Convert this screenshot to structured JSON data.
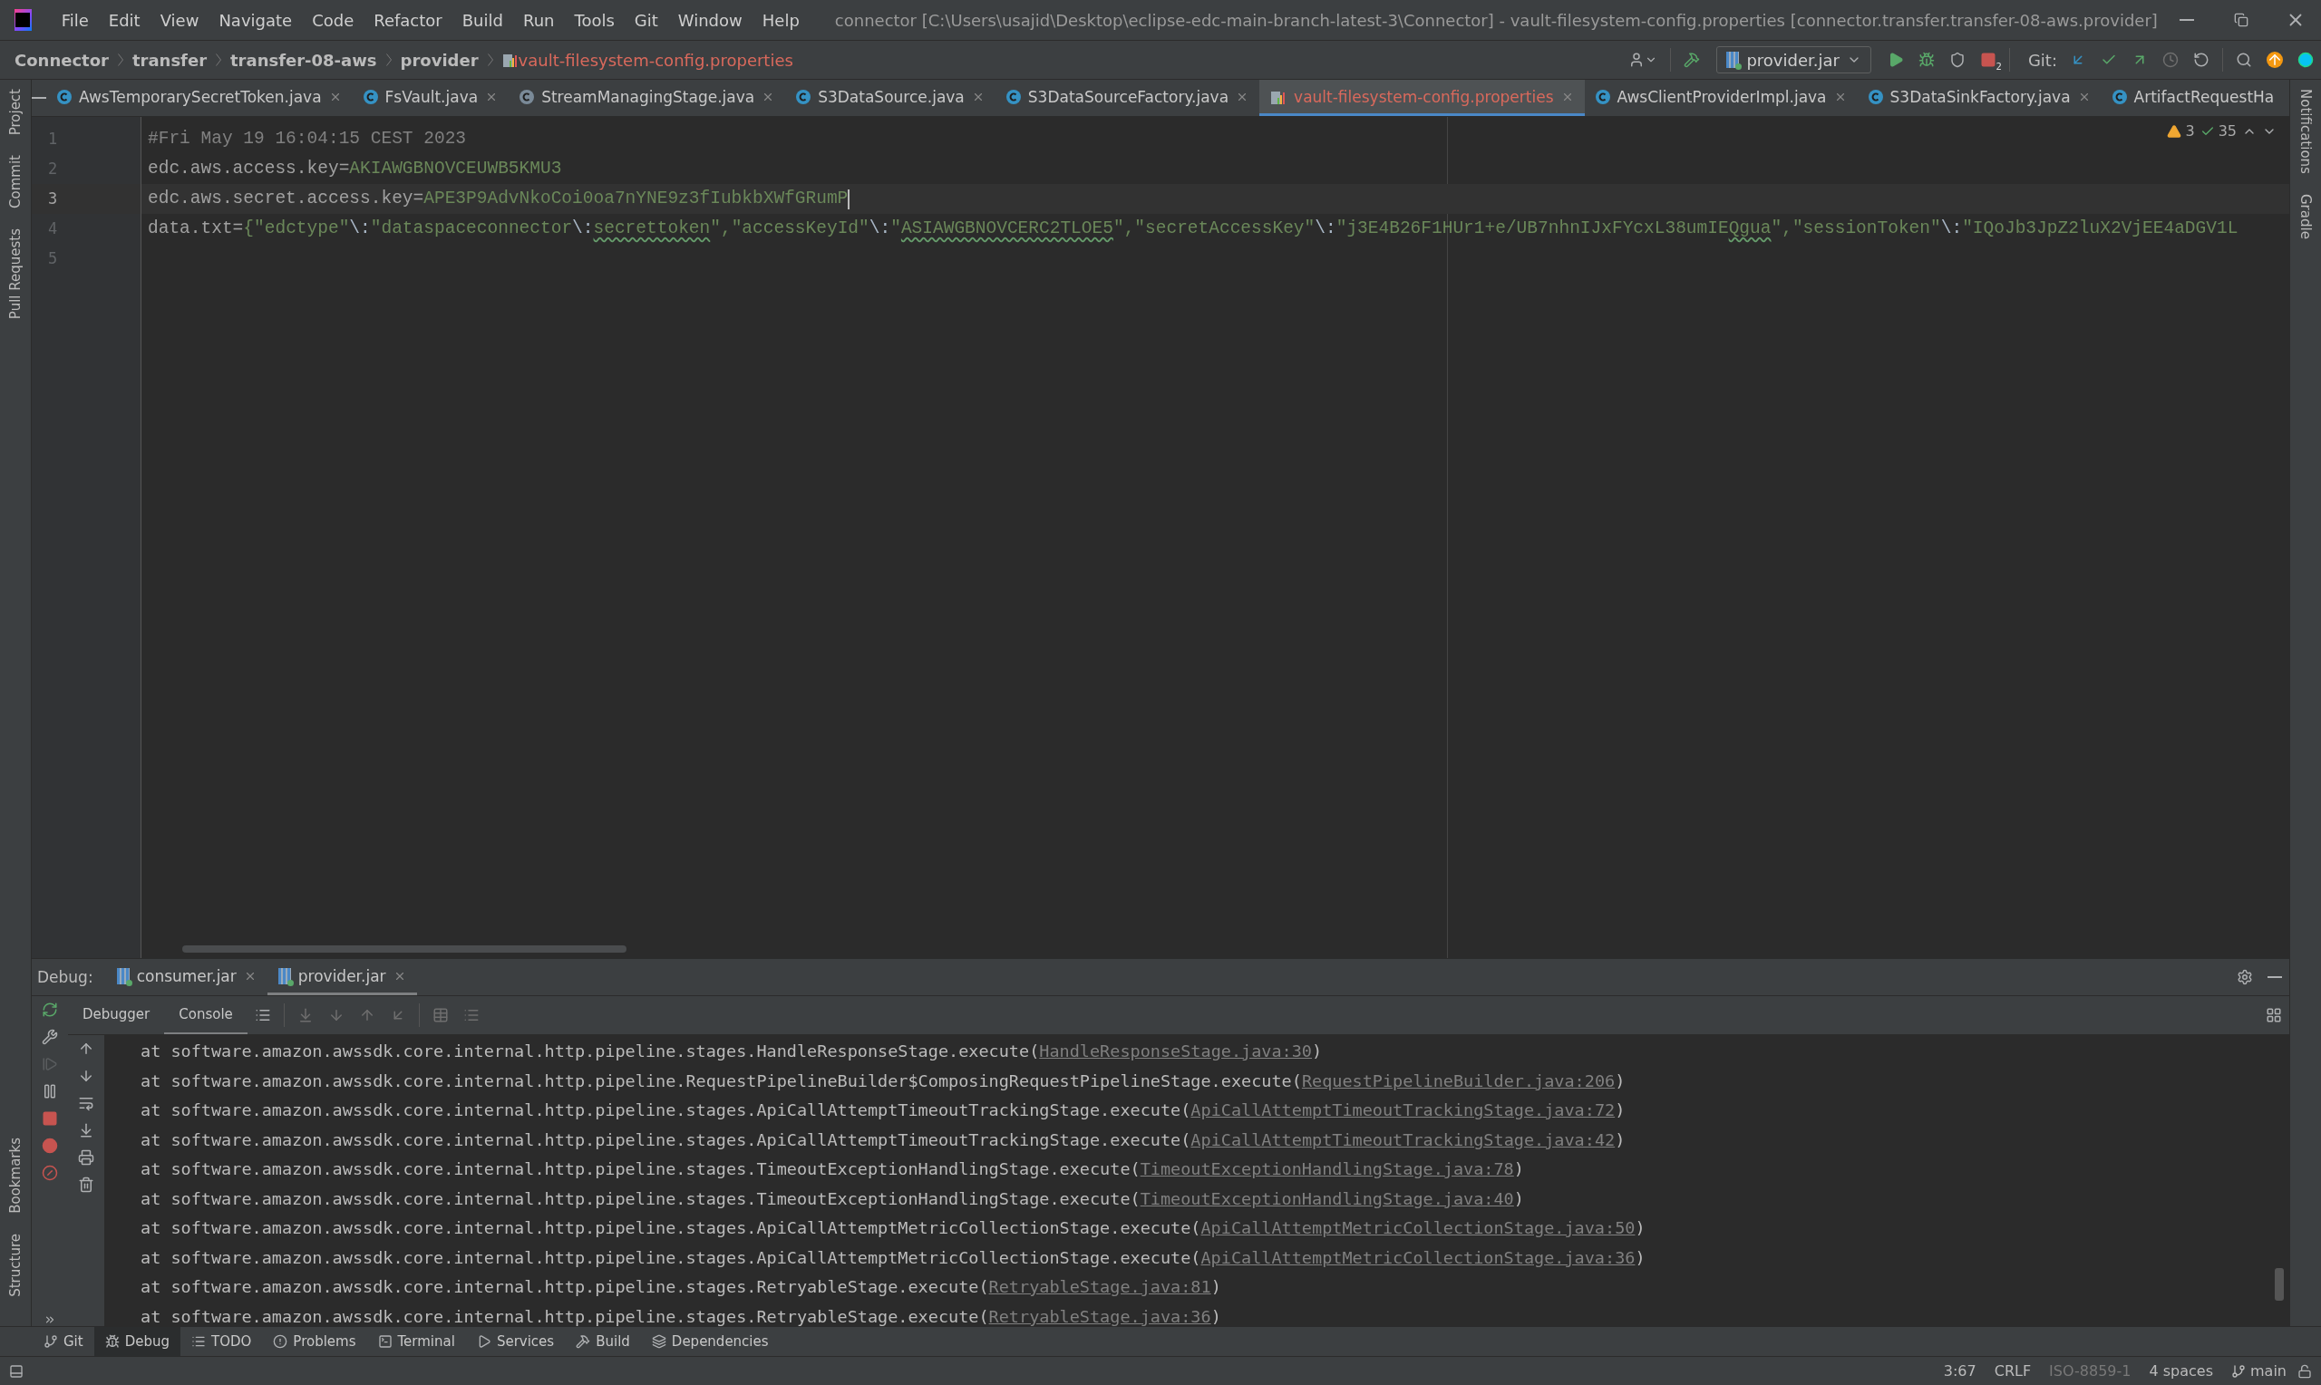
{
  "window": {
    "title": "connector [C:\\Users\\usajid\\Desktop\\eclipse-edc-main-branch-latest-3\\Connector] - vault-filesystem-config.properties [connector.transfer.transfer-08-aws.provider]"
  },
  "menu": [
    "File",
    "Edit",
    "View",
    "Navigate",
    "Code",
    "Refactor",
    "Build",
    "Run",
    "Tools",
    "Git",
    "Window",
    "Help"
  ],
  "breadcrumb": [
    {
      "label": "Connector",
      "kind": "folder",
      "error": false
    },
    {
      "label": "transfer",
      "kind": "folder",
      "error": false
    },
    {
      "label": "transfer-08-aws",
      "kind": "folder",
      "error": false
    },
    {
      "label": "provider",
      "kind": "folder",
      "error": false
    },
    {
      "label": "vault-filesystem-config.properties",
      "kind": "file",
      "error": true
    }
  ],
  "toolbar": {
    "run_config": "provider.jar",
    "stop_badge": "2",
    "vcs_label": "Git:"
  },
  "left_tools": [
    "Project",
    "Commit",
    "Pull Requests"
  ],
  "left_tools_bottom": [
    "Bookmarks",
    "Structure"
  ],
  "right_tools": [
    "Notifications",
    "Gradle"
  ],
  "editor_tabs": [
    {
      "label": "AwsTemporarySecretToken.java",
      "kind": "class",
      "selected": false,
      "error": false
    },
    {
      "label": "FsVault.java",
      "kind": "class",
      "selected": false,
      "error": false
    },
    {
      "label": "StreamManagingStage.java",
      "kind": "abstract",
      "selected": false,
      "error": false
    },
    {
      "label": "S3DataSource.java",
      "kind": "class",
      "selected": false,
      "error": false
    },
    {
      "label": "S3DataSourceFactory.java",
      "kind": "class",
      "selected": false,
      "error": false
    },
    {
      "label": "vault-filesystem-config.properties",
      "kind": "properties",
      "selected": true,
      "error": true
    },
    {
      "label": "AwsClientProviderImpl.java",
      "kind": "class",
      "selected": false,
      "error": false
    },
    {
      "label": "S3DataSinkFactory.java",
      "kind": "class",
      "selected": false,
      "error": false
    },
    {
      "label": "ArtifactRequestHa",
      "kind": "class",
      "selected": false,
      "error": false
    }
  ],
  "inspections": {
    "warnings": "3",
    "checks": "35"
  },
  "editor_lines": [
    {
      "number": "1",
      "current": false,
      "segments": [
        {
          "kind": "comment",
          "text": "#Fri May 19 16:04:15 CEST 2023"
        }
      ]
    },
    {
      "number": "2",
      "current": false,
      "segments": [
        {
          "kind": "key",
          "text": "edc.aws.access.key="
        },
        {
          "kind": "value",
          "text": "AKIAWGBNOVCEUWB5KMU3"
        }
      ]
    },
    {
      "number": "3",
      "current": true,
      "segments": [
        {
          "kind": "key",
          "text": "edc.aws.secret.access.key="
        },
        {
          "kind": "value",
          "text": "APE3P9AdvNkoCoi0oa7nYNE9z3fIubkbXWfGRumP"
        }
      ]
    },
    {
      "number": "4",
      "current": false,
      "segments": [
        {
          "kind": "key",
          "text": "data.txt="
        },
        {
          "kind": "value",
          "text": "{\"edctype\""
        },
        {
          "kind": "escape",
          "text": "\\:"
        },
        {
          "kind": "value",
          "text": "\"dataspaceconnector"
        },
        {
          "kind": "escape",
          "text": "\\:"
        },
        {
          "kind": "typo",
          "text": "secrettoken"
        },
        {
          "kind": "value",
          "text": "\",\"accessKeyId\""
        },
        {
          "kind": "escape",
          "text": "\\:"
        },
        {
          "kind": "value",
          "text": "\""
        },
        {
          "kind": "typo",
          "text": "ASIAWGBNOVCERC2TLOE5"
        },
        {
          "kind": "value",
          "text": "\",\"secretAccessKey\""
        },
        {
          "kind": "escape",
          "text": "\\:"
        },
        {
          "kind": "value",
          "text": "\"j3E4B26F1HUr1+e/UB7nhnIJxFYcxL38umIE"
        },
        {
          "kind": "typo",
          "text": "Qgua"
        },
        {
          "kind": "value",
          "text": "\",\"sessionToken\""
        },
        {
          "kind": "escape",
          "text": "\\:"
        },
        {
          "kind": "value",
          "text": "\"IQoJb3JpZ2luX2VjEE4aDGV1L"
        }
      ]
    },
    {
      "number": "5",
      "current": false
    }
  ],
  "debug": {
    "label": "Debug:",
    "sessions": [
      {
        "label": "consumer.jar",
        "selected": false
      },
      {
        "label": "provider.jar",
        "selected": true
      }
    ],
    "tabs": [
      {
        "label": "Debugger",
        "selected": false
      },
      {
        "label": "Console",
        "selected": true
      }
    ],
    "console_lines": [
      {
        "text": "at software.amazon.awssdk.core.internal.http.pipeline.stages.HandleResponseStage.execute(",
        "link": "HandleResponseStage.java:30",
        "suffix": ")"
      },
      {
        "text": "at software.amazon.awssdk.core.internal.http.pipeline.RequestPipelineBuilder$ComposingRequestPipelineStage.execute(",
        "link": "RequestPipelineBuilder.java:206",
        "suffix": ")"
      },
      {
        "text": "at software.amazon.awssdk.core.internal.http.pipeline.stages.ApiCallAttemptTimeoutTrackingStage.execute(",
        "link": "ApiCallAttemptTimeoutTrackingStage.java:72",
        "suffix": ")"
      },
      {
        "text": "at software.amazon.awssdk.core.internal.http.pipeline.stages.ApiCallAttemptTimeoutTrackingStage.execute(",
        "link": "ApiCallAttemptTimeoutTrackingStage.java:42",
        "suffix": ")"
      },
      {
        "text": "at software.amazon.awssdk.core.internal.http.pipeline.stages.TimeoutExceptionHandlingStage.execute(",
        "link": "TimeoutExceptionHandlingStage.java:78",
        "suffix": ")"
      },
      {
        "text": "at software.amazon.awssdk.core.internal.http.pipeline.stages.TimeoutExceptionHandlingStage.execute(",
        "link": "TimeoutExceptionHandlingStage.java:40",
        "suffix": ")"
      },
      {
        "text": "at software.amazon.awssdk.core.internal.http.pipeline.stages.ApiCallAttemptMetricCollectionStage.execute(",
        "link": "ApiCallAttemptMetricCollectionStage.java:50",
        "suffix": ")"
      },
      {
        "text": "at software.amazon.awssdk.core.internal.http.pipeline.stages.ApiCallAttemptMetricCollectionStage.execute(",
        "link": "ApiCallAttemptMetricCollectionStage.java:36",
        "suffix": ")"
      },
      {
        "text": "at software.amazon.awssdk.core.internal.http.pipeline.stages.RetryableStage.execute(",
        "link": "RetryableStage.java:81",
        "suffix": ")"
      },
      {
        "text": "at software.amazon.awssdk.core.internal.http.pipeline.stages.RetryableStage.execute(",
        "link": "RetryableStage.java:36",
        "suffix": ")"
      }
    ]
  },
  "tool_tabs": [
    {
      "label": "Git",
      "kind": "git",
      "selected": false
    },
    {
      "label": "Debug",
      "kind": "debug",
      "selected": true
    },
    {
      "label": "TODO",
      "kind": "todo",
      "selected": false
    },
    {
      "label": "Problems",
      "kind": "problems",
      "selected": false
    },
    {
      "label": "Terminal",
      "kind": "terminal",
      "selected": false
    },
    {
      "label": "Services",
      "kind": "services",
      "selected": false
    },
    {
      "label": "Build",
      "kind": "build",
      "selected": false
    },
    {
      "label": "Dependencies",
      "kind": "dependencies",
      "selected": false
    }
  ],
  "status_bar": {
    "position": "3:67",
    "line_separator": "CRLF",
    "encoding": {
      "text": "ISO-8859-1",
      "disabled": true
    },
    "indent": "4 spaces",
    "branch": "main"
  }
}
